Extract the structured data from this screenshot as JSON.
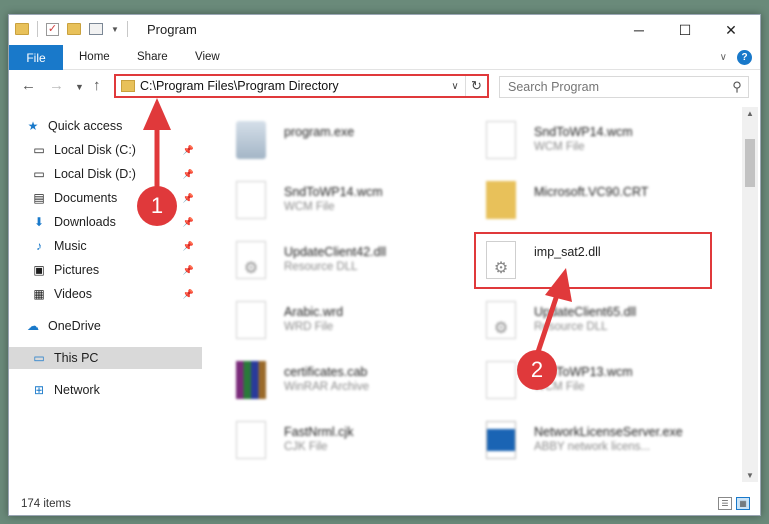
{
  "window": {
    "title": "Program"
  },
  "ribbon": {
    "file_tab": "File",
    "tabs": [
      "Home",
      "Share",
      "View"
    ]
  },
  "address": {
    "path": "C:\\Program Files\\Program Directory"
  },
  "search": {
    "placeholder": "Search Program"
  },
  "sidebar": {
    "quick_access": "Quick access",
    "items": [
      {
        "label": "Local Disk (C:)",
        "icon": "drive-icon"
      },
      {
        "label": "Local Disk (D:)",
        "icon": "drive-icon"
      },
      {
        "label": "Documents",
        "icon": "documents-icon"
      },
      {
        "label": "Downloads",
        "icon": "downloads-icon"
      },
      {
        "label": "Music",
        "icon": "music-icon"
      },
      {
        "label": "Pictures",
        "icon": "pictures-icon"
      },
      {
        "label": "Videos",
        "icon": "videos-icon"
      }
    ],
    "onedrive": "OneDrive",
    "thispc": "This PC",
    "network": "Network"
  },
  "files": {
    "left": [
      {
        "name": "program.exe",
        "type": ""
      },
      {
        "name": "SndToWP14.wcm",
        "type": "WCM File"
      },
      {
        "name": "UpdateClient42.dll",
        "type": "Resource DLL"
      },
      {
        "name": "Arabic.wrd",
        "type": "WRD File"
      },
      {
        "name": "certificates.cab",
        "type": "WinRAR Archive"
      },
      {
        "name": "FastNrml.cjk",
        "type": "CJK File"
      }
    ],
    "right": [
      {
        "name": "SndToWP14.wcm",
        "type": "WCM File"
      },
      {
        "name": "Microsoft.VC90.CRT",
        "type": ""
      },
      {
        "name": "imp_sat2.dll",
        "type": ""
      },
      {
        "name": "UpdateClient65.dll",
        "type": "Resource DLL"
      },
      {
        "name": "SndToWP13.wcm",
        "type": "WCM File"
      },
      {
        "name": "NetworkLicenseServer.exe",
        "type": "ABBY network licens..."
      }
    ]
  },
  "status": {
    "count": "174 items"
  },
  "callouts": {
    "one": "1",
    "two": "2"
  },
  "colors": {
    "accent": "#1979ca",
    "highlight": "#e0393b"
  }
}
